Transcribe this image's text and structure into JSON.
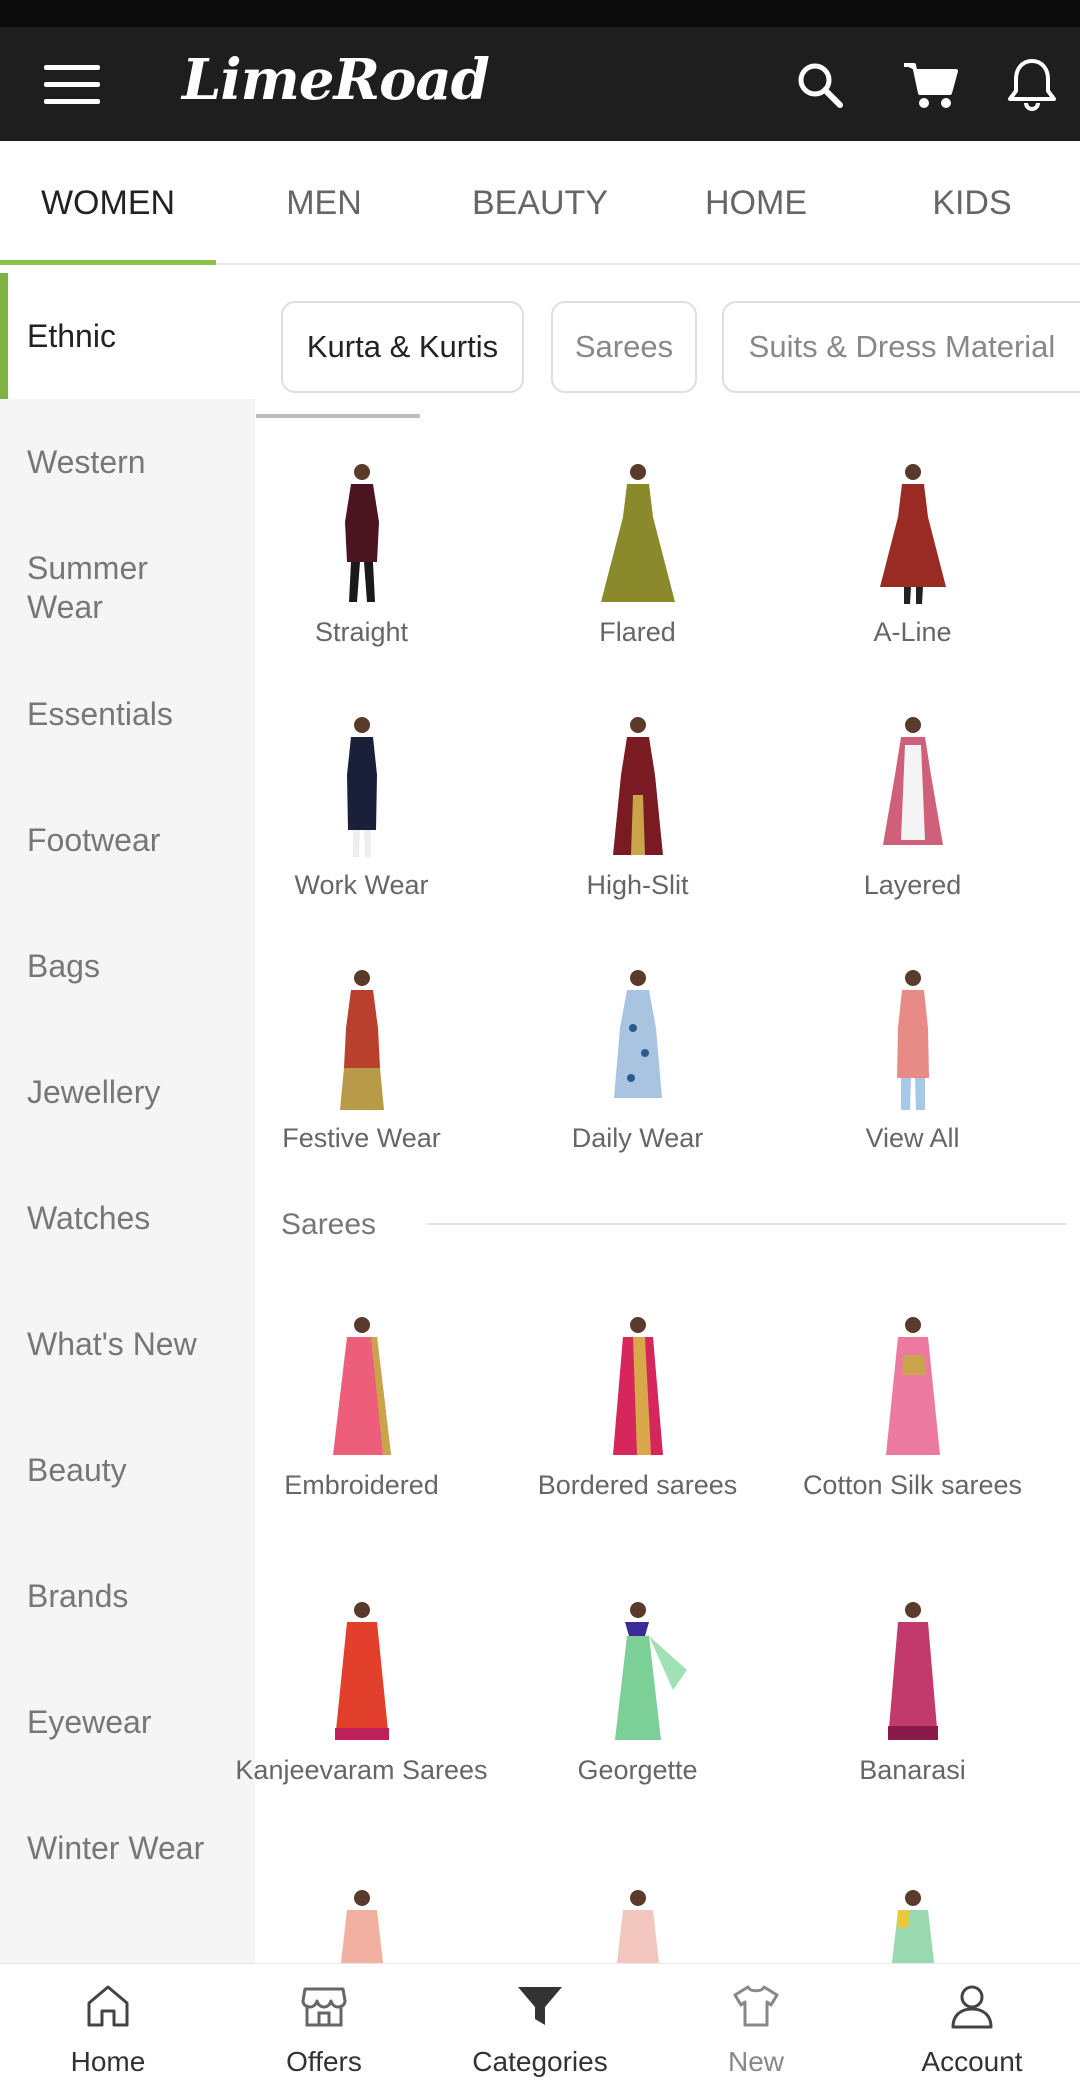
{
  "app": {
    "logo": "LimeRoad"
  },
  "top_tabs": [
    "WOMEN",
    "MEN",
    "BEAUTY",
    "HOME",
    "KIDS"
  ],
  "sidebar": {
    "items": [
      "Ethnic",
      "Western",
      "Summer Wear",
      "Essentials",
      "Footwear",
      "Bags",
      "Jewellery",
      "Watches",
      "What's New",
      "Beauty",
      "Brands",
      "Eyewear",
      "Winter Wear"
    ]
  },
  "chips": [
    "Kurta & Kurtis",
    "Sarees",
    "Suits & Dress Material"
  ],
  "kurtas": {
    "items": [
      "Straight",
      "Flared",
      "A-Line",
      "Work Wear",
      "High-Slit",
      "Layered",
      "Festive Wear",
      "Daily Wear",
      "View All"
    ]
  },
  "sarees": {
    "title": "Sarees",
    "items": [
      "Embroidered",
      "Bordered sarees",
      "Cotton Silk sarees",
      "Kanjeevaram Sarees",
      "Georgette",
      "Banarasi"
    ]
  },
  "bottom_nav": [
    "Home",
    "Offers",
    "Categories",
    "New",
    "Account"
  ],
  "colors": {
    "accent": "#8bc34a",
    "appbar": "#1e1e1e"
  }
}
